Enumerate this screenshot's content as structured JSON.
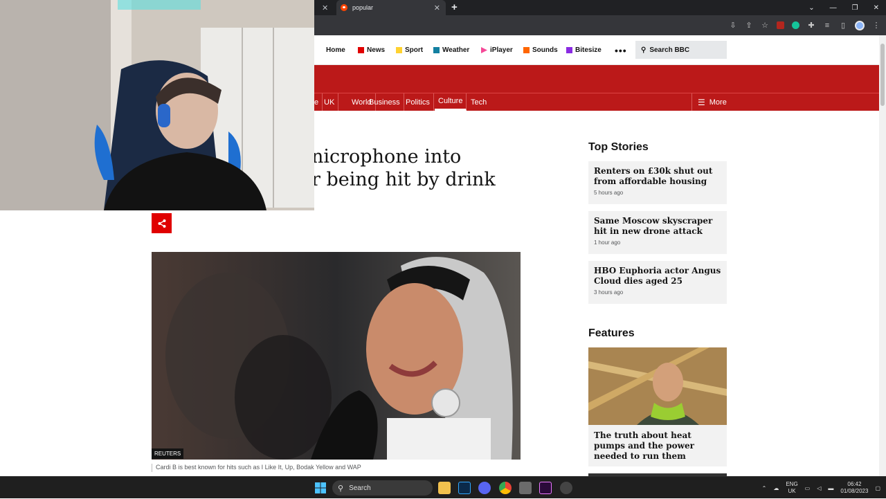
{
  "browser": {
    "tabs": [
      {
        "label": "",
        "active": false
      },
      {
        "label": "popular",
        "active": true
      }
    ],
    "new_tab_glyph": "+",
    "close_glyph": "✕",
    "window_controls": [
      "⌄",
      "—",
      "❐",
      "✕"
    ]
  },
  "nav": {
    "items": [
      {
        "label": "Home",
        "icon": "",
        "color": ""
      },
      {
        "label": "News",
        "icon": "news-icon",
        "color": "#e00000"
      },
      {
        "label": "Sport",
        "icon": "sport-icon",
        "color": "#ffd230"
      },
      {
        "label": "Weather",
        "icon": "weather-icon",
        "color": "#1380a1"
      },
      {
        "label": "iPlayer",
        "icon": "iplayer-icon",
        "color": "#f54997"
      },
      {
        "label": "Sounds",
        "icon": "sounds-icon",
        "color": "#ff6600"
      },
      {
        "label": "Bitesize",
        "icon": "bitesize-icon",
        "color": "#8a2be2"
      }
    ],
    "more_glyph": "•••",
    "search_placeholder": "Search BBC"
  },
  "sections": {
    "items": [
      {
        "label": "e",
        "active": false
      },
      {
        "label": "UK",
        "active": false
      },
      {
        "label": "World",
        "active": false
      },
      {
        "label": "Business",
        "active": false
      },
      {
        "label": "Politics",
        "active": false
      },
      {
        "label": "Culture",
        "active": true
      },
      {
        "label": "Tech",
        "active": false
      }
    ],
    "more_label": "More"
  },
  "article": {
    "headline_line1": "nicrophone into",
    "headline_line2": "r being hit by drink",
    "image_credit": "REUTERS",
    "image_caption": "Cardi B is best known for hits such as I Like It, Up, Bodak Yellow and WAP"
  },
  "top_stories": {
    "heading": "Top Stories",
    "items": [
      {
        "title": "Renters on £30k shut out from affordable housing",
        "time": "5 hours ago"
      },
      {
        "title": "Same Moscow skyscraper hit in new drone attack",
        "time": "1 hour ago"
      },
      {
        "title": "HBO Euphoria actor Angus Cloud dies aged 25",
        "time": "3 hours ago"
      }
    ]
  },
  "features": {
    "heading": "Features",
    "item_title": "The truth about heat pumps and the power needed to run them"
  },
  "taskbar": {
    "search_label": "Search",
    "lang_top": "ENG",
    "lang_bottom": "UK",
    "time": "06:42",
    "date": "01/08/2023"
  }
}
